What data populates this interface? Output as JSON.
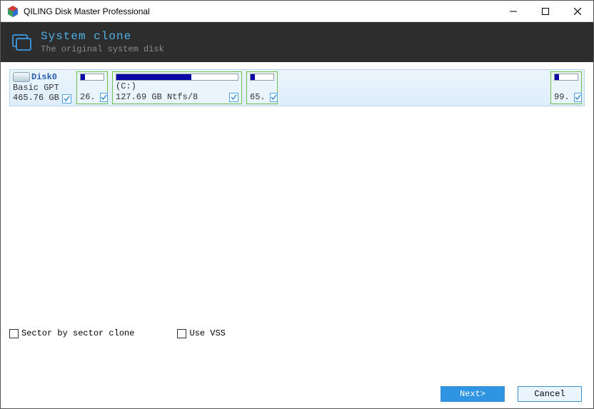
{
  "app": {
    "title": "QILING Disk Master Professional"
  },
  "header": {
    "title": "System clone",
    "subtitle": "The original system disk"
  },
  "disk": {
    "name": "Disk0",
    "type": "Basic GPT",
    "size": "465.76 GB",
    "checked": true,
    "partitions": [
      {
        "label": "",
        "info": "",
        "prefix": "26.",
        "width_class": "p1",
        "fill_pct": 18,
        "checked": true
      },
      {
        "label": "(C:)",
        "info": "127.69 GB Ntfs/8",
        "prefix": "",
        "width_class": "p2",
        "fill_pct": 62,
        "checked": true
      },
      {
        "label": "",
        "info": "",
        "prefix": "65.",
        "width_class": "p3",
        "fill_pct": 18,
        "checked": true
      },
      {
        "label": "",
        "info": "",
        "prefix": "99.",
        "width_class": "p4",
        "fill_pct": 18,
        "checked": true
      }
    ]
  },
  "options": {
    "sector": "Sector by sector clone",
    "vss": "Use VSS"
  },
  "footer": {
    "next": "Next>",
    "cancel": "Cancel"
  }
}
